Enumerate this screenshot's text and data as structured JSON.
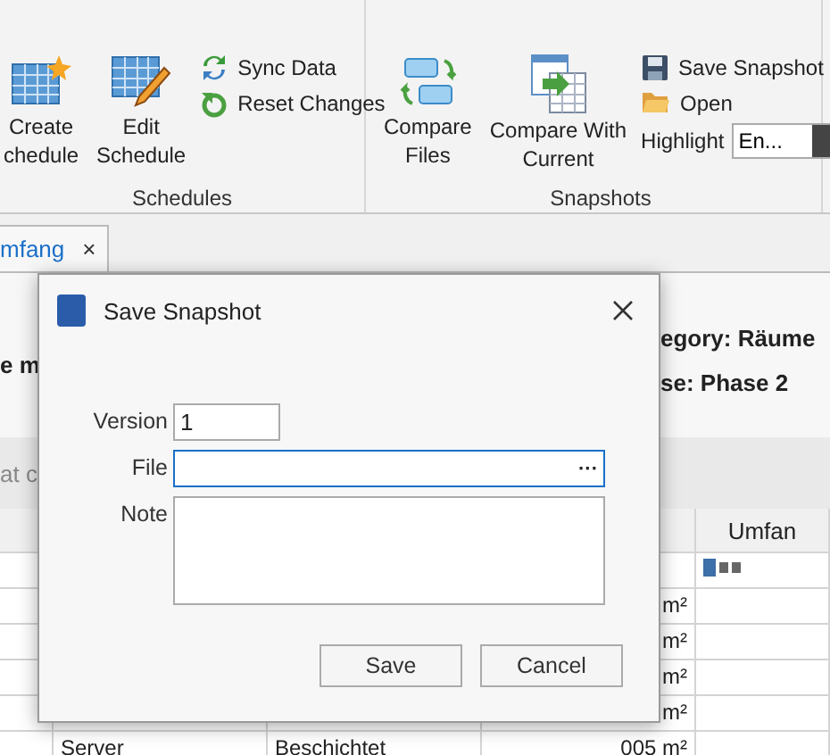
{
  "ribbon": {
    "groups": [
      {
        "label": "Schedules",
        "large_buttons": [
          {
            "kind": "create",
            "lines": [
              "Create",
              "chedule"
            ]
          },
          {
            "kind": "edit",
            "lines": [
              "Edit",
              "Schedule"
            ]
          }
        ],
        "small_buttons": [
          {
            "kind": "sync",
            "label": "Sync Data"
          },
          {
            "kind": "reset",
            "label": "Reset Changes"
          }
        ]
      },
      {
        "label": "Snapshots",
        "large_buttons": [
          {
            "kind": "compare",
            "lines": [
              "Compare",
              "Files"
            ]
          },
          {
            "kind": "current",
            "lines": [
              "Compare With",
              "Current"
            ]
          }
        ],
        "small_buttons": [
          {
            "kind": "save",
            "label": "Save Snapshot"
          },
          {
            "kind": "open",
            "label": "Open"
          }
        ],
        "highlight": {
          "label": "Highlight",
          "value": "En..."
        }
      }
    ]
  },
  "document_tab": {
    "label": "mfang",
    "close": "×"
  },
  "info": {
    "left": "e m",
    "category": "egory: Räume",
    "phase": "se: Phase 2"
  },
  "filter": {
    "placeholder": "at c"
  },
  "table": {
    "header": {
      "column_5": "Umfan"
    },
    "rows": [
      {
        "text_type_icon": true
      },
      {
        "column_4": "m²"
      },
      {
        "column_4": "m²"
      },
      {
        "column_4": "m²"
      },
      {
        "column_4": "m²"
      },
      {
        "column_2": "Server",
        "column_3": "Beschichtet",
        "column_4": "005 m²"
      }
    ]
  },
  "dialog": {
    "title": "Save Snapshot",
    "fields": [
      {
        "kind": "text",
        "label": "Version",
        "value": "1",
        "focused": false
      },
      {
        "kind": "file",
        "label": "File",
        "browse": "···",
        "focused": true
      },
      {
        "kind": "note",
        "label": "Note",
        "focused": false
      }
    ],
    "buttons": [
      "Save",
      "Cancel"
    ]
  }
}
